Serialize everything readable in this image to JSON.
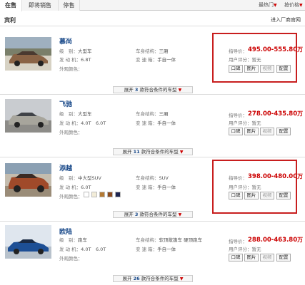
{
  "tabs": [
    {
      "label": "在售"
    },
    {
      "label": "即将销售"
    },
    {
      "label": "停售"
    }
  ],
  "sort": {
    "label": "最热门",
    "arrow": "▼",
    "label2": "按价格",
    "arrow2": "▼"
  },
  "brand": {
    "name": "宾利",
    "link": "进入厂商官网"
  },
  "labels": {
    "level": "级　别：",
    "engine": "发 动 机：",
    "color": "外观颜色：",
    "body": "车身结构：",
    "trans": "变 速 箱：",
    "price": "指导价：",
    "rating": "用户评分：",
    "expand_pre": "展开",
    "expand_post": "款符合条件的车型",
    "caret": "▼"
  },
  "buttons": {
    "koubei": "口碑",
    "pic": "图片",
    "video": "视频",
    "config": "配置"
  },
  "cars": [
    {
      "name": "慕尚",
      "level": "大型车",
      "engine": "6.8T",
      "body": "三厢",
      "trans": "手自一体",
      "price": "495.00-555.80",
      "unit": "万",
      "rating": "暂无",
      "expand_count": "3"
    },
    {
      "name": "飞驰",
      "level": "大型车",
      "engine": "4.0T　6.0T",
      "body": "三厢",
      "trans": "手自一体",
      "price": "278.00-435.80",
      "unit": "万",
      "rating": "暂无",
      "expand_count": "11"
    },
    {
      "name": "添越",
      "level": "中大型SUV",
      "engine": "6.0T",
      "body": "SUV",
      "trans": "手自一体",
      "price": "398.00-480.00",
      "unit": "万",
      "rating": "暂无",
      "expand_count": "3",
      "swatches": [
        "#ffffff",
        "#f2ecd8",
        "#b47a35",
        "#8a4a1e",
        "#1c2450"
      ]
    },
    {
      "name": "欧陆",
      "level": "跑车",
      "engine": "4.0T　6.0T",
      "body": "软顶敞篷车 硬顶跑车",
      "trans": "手自一体",
      "price": "288.00-463.80",
      "unit": "万",
      "rating": "暂无",
      "expand_count": "26"
    }
  ],
  "colors": {
    "accent_red": "#c00000",
    "link_blue": "#1a4a8a",
    "highlight_box": "#c81e1e"
  }
}
